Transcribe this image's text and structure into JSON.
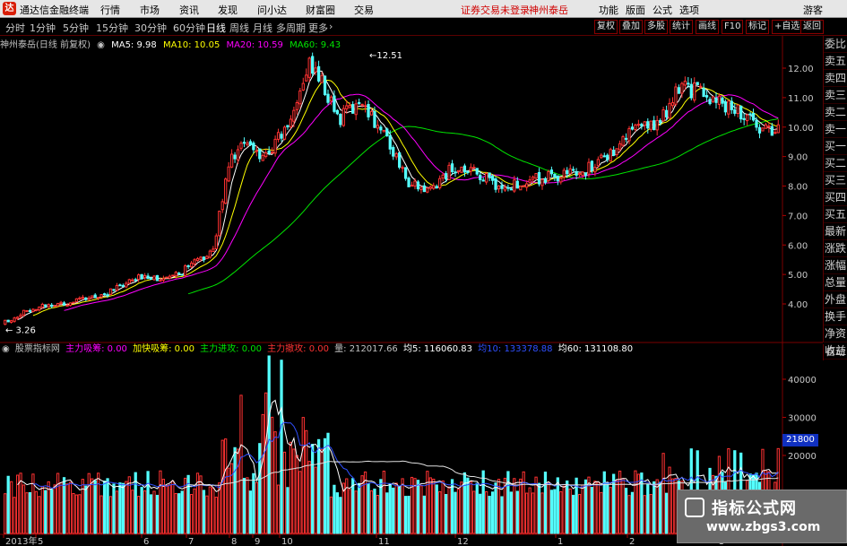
{
  "titlebar": {
    "logo": "达",
    "app_name": "通达信金融终端",
    "menus": [
      "行情",
      "市场",
      "资讯",
      "发现",
      "问小达",
      "财富圈",
      "交易"
    ],
    "warning": "证券交易未登录",
    "stock_name": "神州泰岳",
    "right_menus": [
      "功能",
      "版面",
      "公式",
      "选项"
    ],
    "guest": "游客"
  },
  "toolbar": {
    "periods": [
      "分时",
      "1分钟",
      "5分钟",
      "15分钟",
      "30分钟",
      "60分钟",
      "日线",
      "周线",
      "月线",
      "多周期",
      "更多"
    ],
    "active_period": "日线",
    "right_buttons": [
      "复权",
      "叠加",
      "多股",
      "统计",
      "画线",
      "F10",
      "标记",
      "+自选",
      "返回"
    ]
  },
  "main_legend": {
    "title": "神州泰岳(日线 前复权)",
    "ma5": "MA5: 9.98",
    "ma10": "MA10: 10.05",
    "ma20": "MA20: 10.59",
    "ma60": "MA60: 9.43"
  },
  "price_axis": [
    "12.00",
    "11.00",
    "10.00",
    "9.00",
    "8.00",
    "7.00",
    "6.00",
    "5.00",
    "4.00"
  ],
  "price_annotations": {
    "high": "12.51",
    "low": "3.26"
  },
  "right_panel": [
    "委比",
    "卖五",
    "卖四",
    "卖三",
    "卖二",
    "卖一",
    "买一",
    "买二",
    "买三",
    "买四",
    "买五",
    "最新",
    "涨跌",
    "涨幅",
    "总量",
    "外盘",
    "换手",
    "净资",
    "收益"
  ],
  "auto_button": "自动",
  "sub_legend": {
    "title": "股票指标网",
    "l1": "主力吸筹: 0.00",
    "l2": "加快吸筹: 0.00",
    "l3": "主力进攻: 0.00",
    "l4": "主力撤攻: 0.00",
    "l5": "量: 212017.66",
    "l6": "均5: 116060.83",
    "l7": "均10: 133378.88",
    "l8": "均60: 131108.80"
  },
  "volume_axis": [
    "40000",
    "30000",
    "20000"
  ],
  "volume_box": "21800",
  "date_axis": [
    "2013年",
    "5",
    "6",
    "7",
    "8",
    "9",
    "10",
    "11",
    "12",
    "1",
    "2",
    "3"
  ],
  "watermark": {
    "title": "指标公式网",
    "url": "www.zbgs3.com"
  },
  "colors": {
    "up": "#ff3232",
    "down": "#54ffff",
    "ma5": "#ffffff",
    "ma10": "#ffff00",
    "ma20": "#ff00ff",
    "ma60": "#00e600"
  }
}
